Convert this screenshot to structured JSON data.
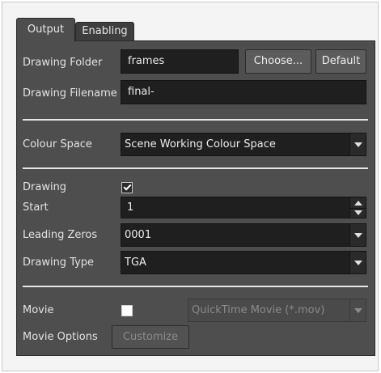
{
  "tabs": [
    {
      "label": "Output",
      "active": true
    },
    {
      "label": "Enabling",
      "active": false
    }
  ],
  "output": {
    "drawing_folder": {
      "label": "Drawing Folder",
      "value": "frames",
      "choose_label": "Choose...",
      "default_label": "Default"
    },
    "drawing_filename": {
      "label": "Drawing Filename",
      "value": "final-"
    },
    "colour_space": {
      "label": "Colour Space",
      "value": "Scene Working Colour Space"
    },
    "drawing": {
      "label": "Drawing",
      "checked": true
    },
    "start": {
      "label": "Start",
      "value": "1"
    },
    "leading_zeros": {
      "label": "Leading Zeros",
      "value": "0001"
    },
    "drawing_type": {
      "label": "Drawing Type",
      "value": "TGA"
    },
    "movie": {
      "label": "Movie",
      "checked": false,
      "format": "QuickTime Movie (*.mov)"
    },
    "movie_options": {
      "label": "Movie Options",
      "button_label": "Customize"
    }
  },
  "colors": {
    "panel_bg": "#4e4e4e",
    "field_bg": "#1f1f1f",
    "separator": "#e6e6e6"
  }
}
